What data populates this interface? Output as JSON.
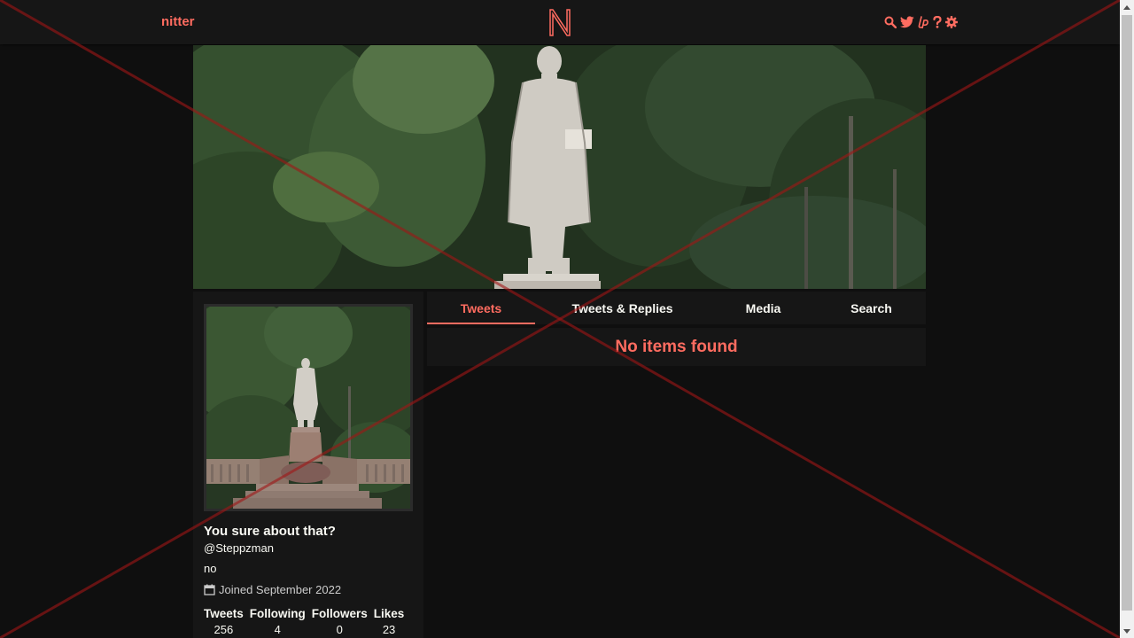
{
  "nav": {
    "brand": "nitter",
    "logo_letter": "N",
    "icons": [
      "search-icon",
      "twitter-bird-icon",
      "liberapay-icon",
      "question-icon",
      "gear-icon"
    ]
  },
  "profile": {
    "fullname": "You sure about that?",
    "username": "@Steppzman",
    "bio": "no",
    "joined": "Joined September 2022",
    "stats": [
      {
        "label": "Tweets",
        "value": "256"
      },
      {
        "label": "Following",
        "value": "4"
      },
      {
        "label": "Followers",
        "value": "0"
      },
      {
        "label": "Likes",
        "value": "23"
      }
    ]
  },
  "tabs": [
    {
      "label": "Tweets",
      "active": true
    },
    {
      "label": "Tweets & Replies",
      "active": false
    },
    {
      "label": "Media",
      "active": false
    },
    {
      "label": "Search",
      "active": false
    }
  ],
  "timeline": {
    "empty_message": "No items found"
  },
  "colors": {
    "accent": "#ff6c60",
    "background": "#0f0f0f",
    "panel": "#161616",
    "text": "#f8f8f2"
  }
}
